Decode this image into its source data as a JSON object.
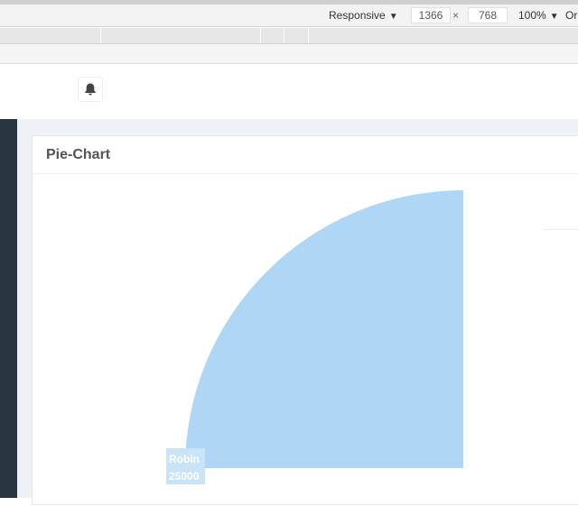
{
  "devtools": {
    "device": "Responsive",
    "width": "1366",
    "times": "×",
    "height": "768",
    "zoom": "100%",
    "throttle": "Or"
  },
  "header": {
    "notification_icon": "bell-icon"
  },
  "card": {
    "title": "Pie-Chart"
  },
  "chart_data": {
    "type": "pie",
    "slices": [
      {
        "label": "Robin",
        "value": 25000,
        "color": "#b0d6f5"
      }
    ],
    "start_angle_deg": 0,
    "visible_sweep_deg": 90
  },
  "colors": {
    "sidebar": "#2a3542",
    "content_bg": "#eef1f6",
    "slice": "#b0d6f5"
  }
}
